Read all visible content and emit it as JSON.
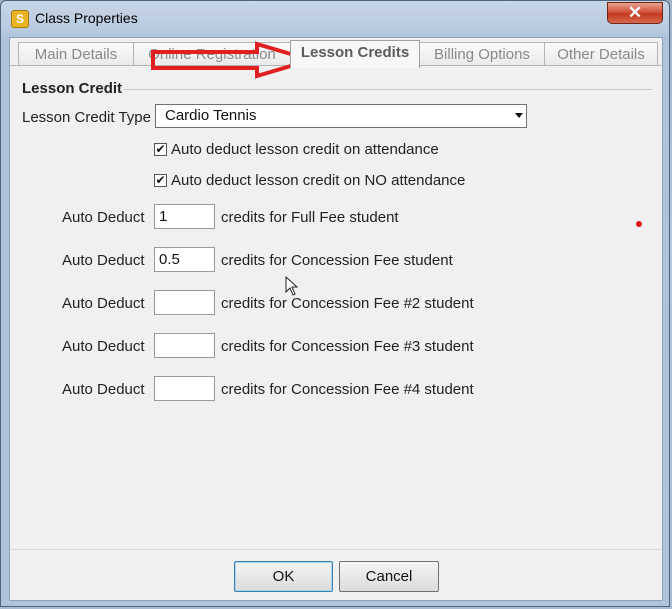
{
  "window": {
    "title": "Class Properties",
    "close_glyph": "✕"
  },
  "tabs": [
    {
      "label": "Main Details",
      "active": false
    },
    {
      "label": "Online Registration",
      "active": false
    },
    {
      "label": "Lesson Credits",
      "active": true
    },
    {
      "label": "Billing Options",
      "active": false
    },
    {
      "label": "Other Details",
      "active": false
    }
  ],
  "lesson_credit": {
    "section_title": "Lesson Credit",
    "type_label": "Lesson Credit Type",
    "type_value": "Cardio Tennis",
    "auto_deduct_attendance": {
      "label": "Auto deduct lesson credit on attendance",
      "checked": true
    },
    "auto_deduct_no_attendance": {
      "label": "Auto deduct lesson credit on NO attendance",
      "checked": true
    },
    "deduct_rows": [
      {
        "prefix": "Auto Deduct",
        "value": "1",
        "suffix": "credits for Full Fee student"
      },
      {
        "prefix": "Auto Deduct",
        "value": "0.5",
        "suffix": "credits for Concession Fee student"
      },
      {
        "prefix": "Auto Deduct",
        "value": "",
        "suffix": "credits for Concession Fee #2 student"
      },
      {
        "prefix": "Auto Deduct",
        "value": "",
        "suffix": "credits for Concession Fee #3 student"
      },
      {
        "prefix": "Auto Deduct",
        "value": "",
        "suffix": "credits for Concession Fee #4 student"
      }
    ]
  },
  "buttons": {
    "ok": "OK",
    "cancel": "Cancel"
  },
  "colors": {
    "annotation_arrow": "#e02020",
    "close_button": "#c94a32"
  },
  "icons": {
    "app": "app-logo-icon",
    "check": "✔"
  }
}
